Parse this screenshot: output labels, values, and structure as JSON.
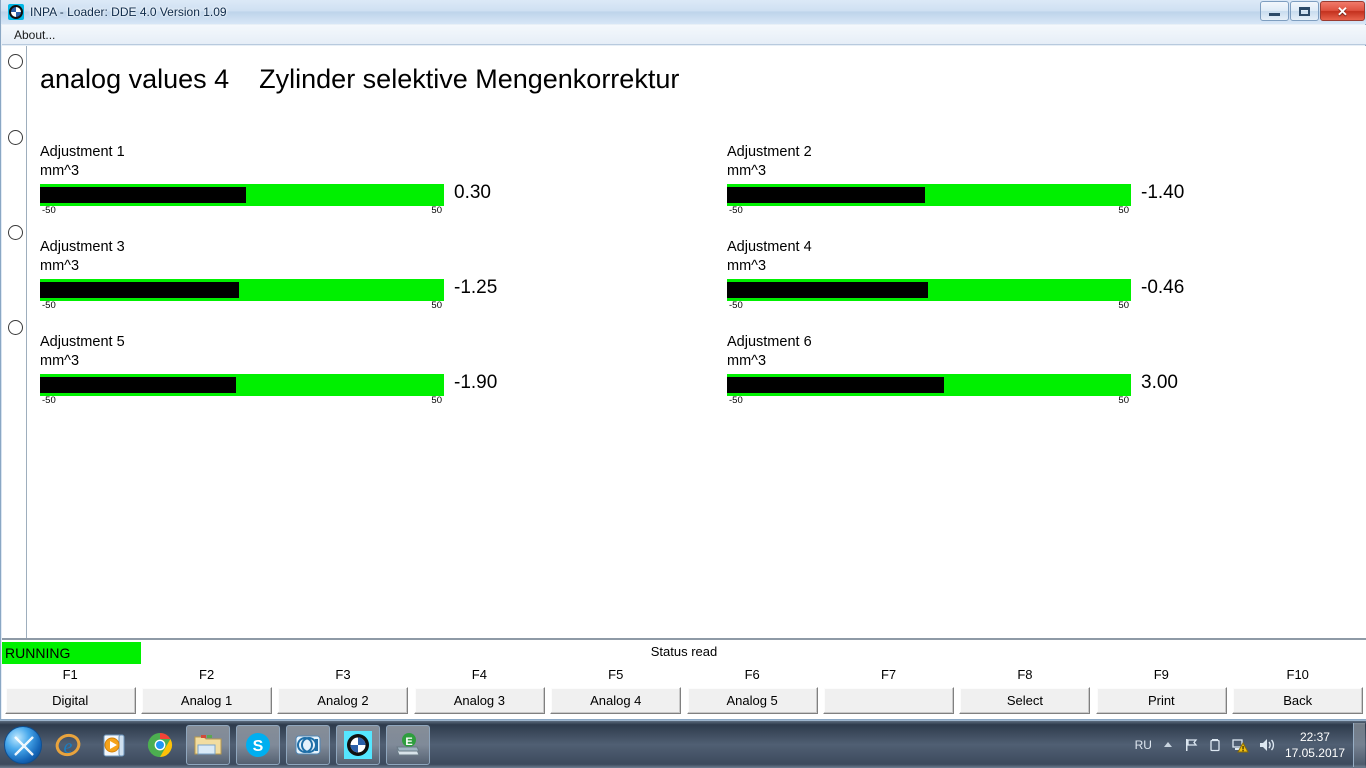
{
  "window": {
    "title": "INPA - Loader:  DDE 4.0 Version 1.09",
    "icon": "bmw-icon",
    "minimize_label": "–",
    "maximize_label": "",
    "close_label": "✕"
  },
  "menubar": {
    "items": [
      {
        "label": "About..."
      }
    ]
  },
  "page": {
    "title": "analog values 4    Zylinder selektive Mengenkorrektur"
  },
  "gauges": [
    {
      "label": "Adjustment 1",
      "unit": "mm^3",
      "value": "0.30",
      "min": "-50",
      "max": "50",
      "fill_pct": 51.0
    },
    {
      "label": "Adjustment 2",
      "unit": "mm^3",
      "value": "-1.40",
      "min": "-50",
      "max": "50",
      "fill_pct": 49.0
    },
    {
      "label": "Adjustment 3",
      "unit": "mm^3",
      "value": "-1.25",
      "min": "-50",
      "max": "50",
      "fill_pct": 49.2
    },
    {
      "label": "Adjustment 4",
      "unit": "mm^3",
      "value": "-0.46",
      "min": "-50",
      "max": "50",
      "fill_pct": 49.8
    },
    {
      "label": "Adjustment 5",
      "unit": "mm^3",
      "value": "-1.90",
      "min": "-50",
      "max": "50",
      "fill_pct": 48.6
    },
    {
      "label": "Adjustment 6",
      "unit": "mm^3",
      "value": "3.00",
      "min": "-50",
      "max": "50",
      "fill_pct": 53.8
    }
  ],
  "status": {
    "running_label": "RUNNING",
    "status_text": "Status read",
    "running_color": "#00f000"
  },
  "function_keys": [
    {
      "key": "F1",
      "label": "Digital"
    },
    {
      "key": "F2",
      "label": "Analog 1"
    },
    {
      "key": "F3",
      "label": "Analog 2"
    },
    {
      "key": "F4",
      "label": "Analog 3"
    },
    {
      "key": "F5",
      "label": "Analog 4"
    },
    {
      "key": "F6",
      "label": "Analog 5"
    },
    {
      "key": "F7",
      "label": ""
    },
    {
      "key": "F8",
      "label": "Select"
    },
    {
      "key": "F9",
      "label": "Print"
    },
    {
      "key": "F10",
      "label": "Back"
    }
  ],
  "taskbar": {
    "start_icon": "windows-start-icon",
    "quick_launch": [
      {
        "icon": "internet-explorer-icon"
      },
      {
        "icon": "media-player-icon"
      },
      {
        "icon": "google-chrome-icon"
      }
    ],
    "windows": [
      {
        "icon": "file-explorer-icon"
      },
      {
        "icon": "skype-icon"
      },
      {
        "icon": "media-app-icon"
      },
      {
        "icon": "bmw-inpa-icon"
      },
      {
        "icon": "ediabas-icon"
      }
    ],
    "tray": {
      "language": "RU",
      "icons": [
        "show-hidden-icons-arrow",
        "flag-action-center-icon",
        "battery-icon",
        "network-warning-icon",
        "volume-icon"
      ],
      "time": "22:37",
      "date": "17.05.2017"
    }
  },
  "colors": {
    "bar_green": "#00f000",
    "bar_black": "#000000",
    "accent": "#2b5fa8"
  }
}
